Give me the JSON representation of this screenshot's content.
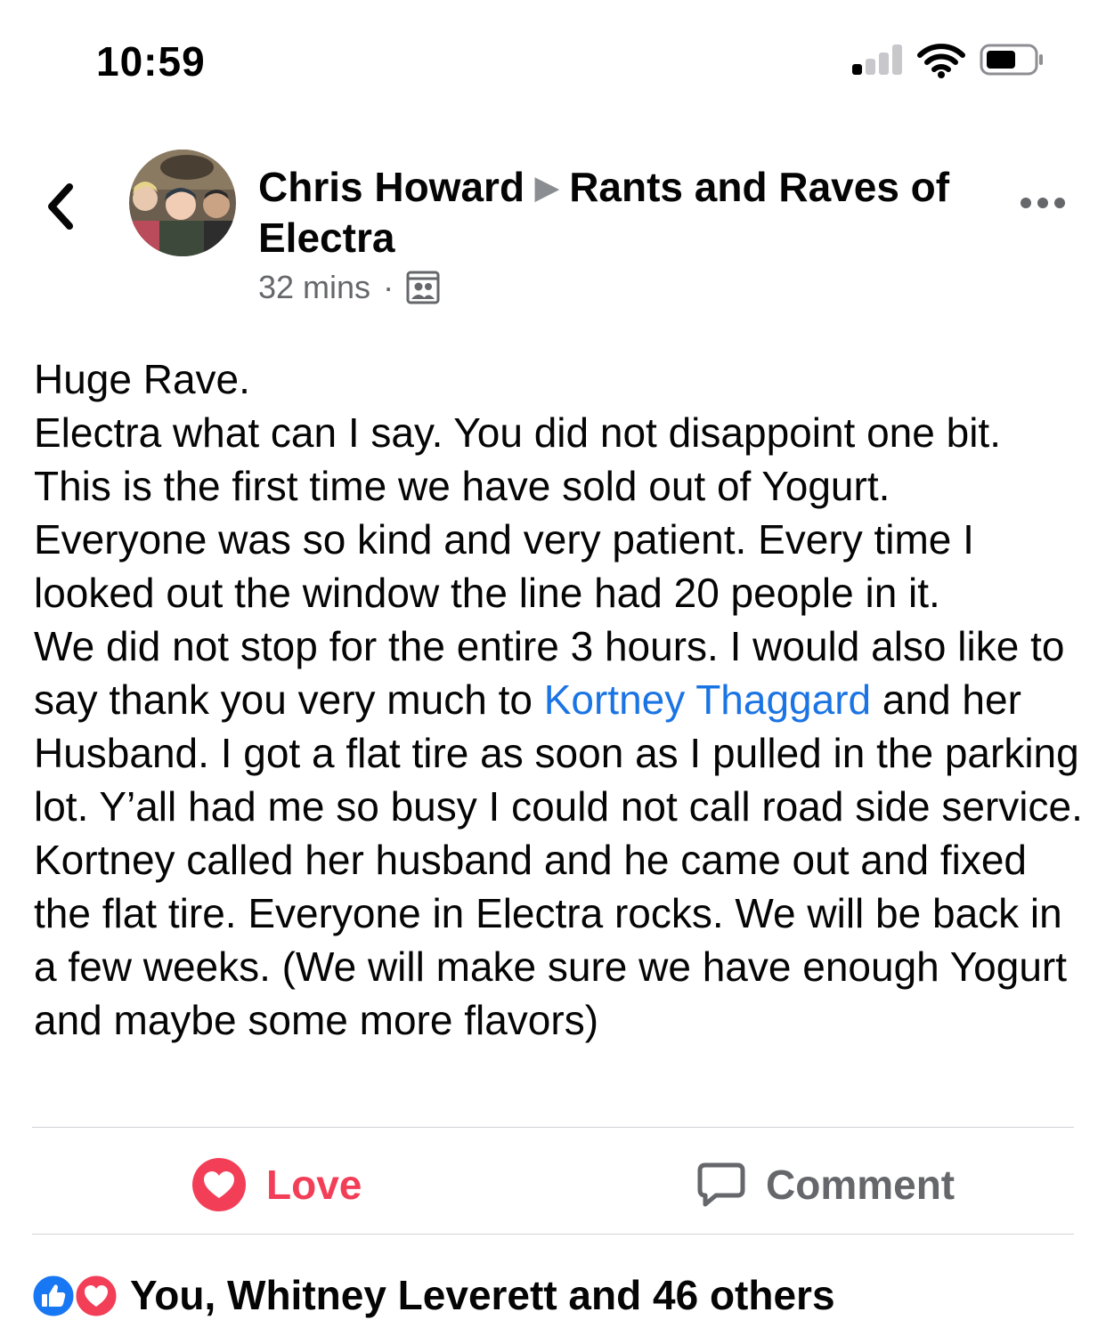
{
  "status_bar": {
    "time": "10:59",
    "signal_icon": "cellular-signal-icon",
    "wifi_icon": "wifi-icon",
    "battery_icon": "battery-icon"
  },
  "header": {
    "back_icon": "chevron-left-icon",
    "author": "Chris Howard",
    "separator_icon": "triangle-right-icon",
    "group": "Rants and Raves of Electra",
    "time_ago": "32 mins",
    "audience_icon": "group-audience-icon",
    "more_icon": "more-horizontal-icon"
  },
  "post": {
    "text_before_mention": "Huge Rave.\nElectra what can I say. You did not disappoint one bit. This is the first time we have sold out of Yogurt.\nEveryone was so kind and very patient. Every time I looked out the window the line had 20 people in it.\nWe did not stop for the entire 3 hours. I would also like to say thank you very much to ",
    "mention": "Kortney Thaggard",
    "text_after_mention": " and her Husband. I got a flat tire as soon as I pulled in the parking lot. Y’all had me so busy I could not call road side service. Kortney called her husband and he came out and fixed the flat tire. Everyone in Electra rocks. We will be back in a few weeks. (We will make sure we have enough Yogurt and maybe some more flavors)"
  },
  "actions": {
    "love_label": "Love",
    "love_icon": "heart-icon",
    "comment_label": "Comment",
    "comment_icon": "comment-bubble-icon"
  },
  "reactions": {
    "summary": "You, Whitney Leverett and 46 others",
    "icons": [
      "like-icon",
      "love-icon"
    ]
  },
  "colors": {
    "love": "#f33e58",
    "link": "#1b74e4",
    "like": "#1877f2",
    "secondary_text": "#65676b"
  }
}
